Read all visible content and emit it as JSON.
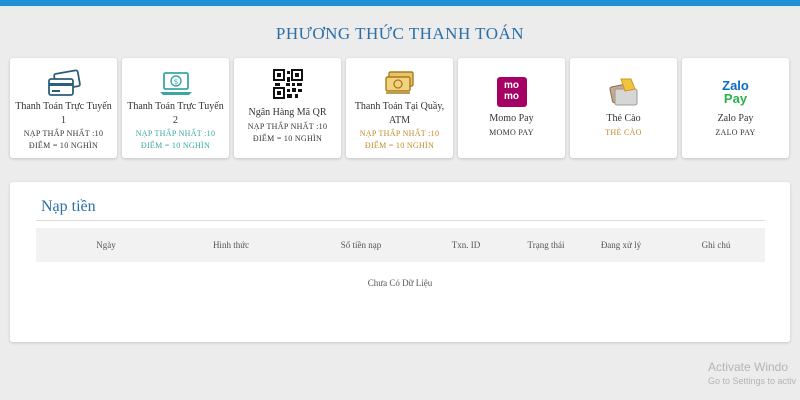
{
  "header": {
    "title": "PHƯƠNG THỨC THANH TOÁN"
  },
  "colors": {
    "top_bar": "#1e90d6",
    "title": "#2a6fa8",
    "teal": "#3aa7a0",
    "gold": "#c08a26",
    "red": "#d2262c"
  },
  "payment_methods": [
    {
      "icon": "credit-cards-icon",
      "name": "Thanh Toán Trực Tuyến 1",
      "line1": "NẠP THẤP NHẤT :10",
      "line2": "ĐIỂM = 10 NGHÌN"
    },
    {
      "icon": "laptop-dollar-icon",
      "name": "Thanh Toán Trực Tuyến 2",
      "line1": "NẠP THẤP NHẤT :10",
      "line2": "ĐIỂM = 10 NGHÌN"
    },
    {
      "icon": "qr-code-icon",
      "name": "Ngân Hàng Mã QR",
      "line1": "NẠP THẤP NHẤT :10",
      "line2": "ĐIỂM = 10 NGHÌN"
    },
    {
      "icon": "cash-icon",
      "name": "Thanh Toán Tại Quầy, ATM",
      "line1": "NẠP THẤP NHẤT :10",
      "line2": "ĐIỂM = 10 NGHÌN"
    },
    {
      "icon": "momo-logo-icon",
      "name": "Momo Pay",
      "line1": "MOMO PAY",
      "logo_text": [
        "mo",
        "mo"
      ]
    },
    {
      "icon": "scratch-card-icon",
      "name": "Thẻ Cào",
      "line1": "THẺ CÀO"
    },
    {
      "icon": "zalopay-logo-icon",
      "name": "Zalo Pay",
      "line1": "ZALO PAY",
      "logo_text": [
        "Zalo",
        "Pay"
      ]
    }
  ],
  "deposit": {
    "title": "Nạp tiền",
    "columns": [
      "Ngày",
      "Hình thức",
      "Số tiền nạp",
      "Txn. ID",
      "Trạng thái",
      "Đang xử lý",
      "Ghi chú"
    ],
    "empty_text": "Chưa Có Dữ Liệu"
  },
  "watermark": {
    "line1": "Activate Windo",
    "line2": "Go to Settings to activ"
  }
}
